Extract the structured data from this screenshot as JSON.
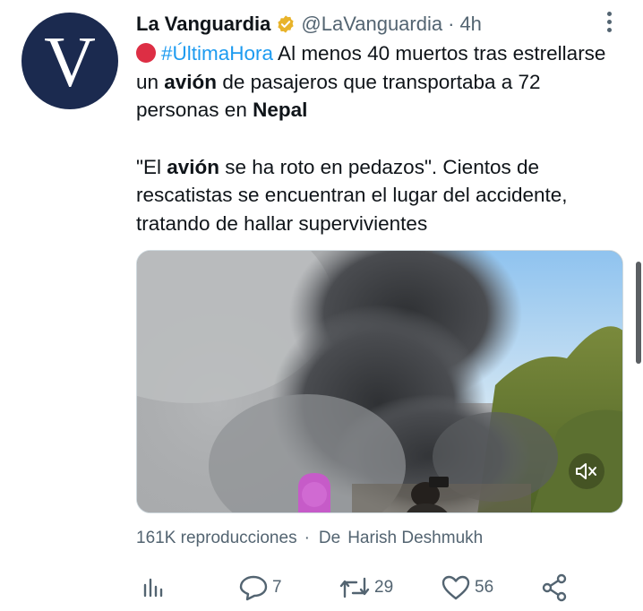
{
  "author": {
    "avatar_letter": "V",
    "display_name": "La Vanguardia",
    "handle": "@LaVanguardia",
    "separator": "·",
    "time": "4h"
  },
  "tweet": {
    "line1": {
      "hashtag": "#ÚltimaHora",
      "t1": " Al menos 40 muertos tras estrellarse un ",
      "b1": "avión",
      "t2": " de pasajeros que transportaba a 72 personas en ",
      "b2": "Nepal"
    },
    "line2": {
      "t1": "\"El ",
      "b1": "avión",
      "t2": " se ha roto en pedazos\". Cientos de rescatistas se encuentran el lugar del accidente, tratando de hallar supervivientes"
    }
  },
  "media": {
    "type": "video",
    "audio_state": "muted",
    "icon": "speaker-muted-icon"
  },
  "meta": {
    "views": "161K reproducciones",
    "separator": "·",
    "from_label": "De",
    "from_name": "Harish Deshmukh"
  },
  "actions": {
    "analytics_icon": "analytics-icon",
    "replies": "7",
    "retweets": "29",
    "likes": "56",
    "share_icon": "share-icon"
  },
  "colors": {
    "accent": "#1d9bf0",
    "verified_badge": "#e8b32a",
    "avatar_bg": "#1b2a4f",
    "breaking_dot": "#dd2e44",
    "secondary_text": "#536471"
  }
}
